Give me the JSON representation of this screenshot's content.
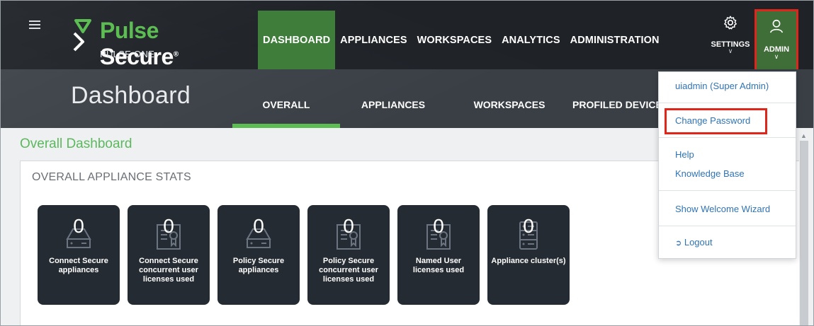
{
  "app": {
    "brand_pulse": "Pulse",
    "brand_secure": "Secure",
    "brand_reg": "®",
    "product": "PULSE ONE"
  },
  "nav": {
    "items": [
      {
        "label": "DASHBOARD",
        "active": true
      },
      {
        "label": "APPLIANCES",
        "active": false
      },
      {
        "label": "WORKSPACES",
        "active": false
      },
      {
        "label": "ANALYTICS",
        "active": false
      },
      {
        "label": "ADMINISTRATION",
        "active": false
      }
    ],
    "settings_label": "SETTINGS",
    "admin_label": "ADMIN"
  },
  "subbar": {
    "title": "Dashboard",
    "tabs": [
      {
        "label": "OVERALL",
        "active": true
      },
      {
        "label": "APPLIANCES",
        "active": false
      },
      {
        "label": "WORKSPACES",
        "active": false
      },
      {
        "label": "PROFILED DEVICES",
        "active": false
      }
    ]
  },
  "content": {
    "section_title": "Overall Dashboard",
    "panel_title": "OVERALL APPLIANCE STATS",
    "cards": [
      {
        "value": "0",
        "label": "Connect Secure appliances",
        "icon": "appliance-icon"
      },
      {
        "value": "0",
        "label": "Connect Secure concurrent user licenses used",
        "icon": "license-certificate-icon"
      },
      {
        "value": "0",
        "label": "Policy Secure appliances",
        "icon": "appliance-icon"
      },
      {
        "value": "0",
        "label": "Policy Secure concurrent user licenses used",
        "icon": "license-certificate-icon"
      },
      {
        "value": "0",
        "label": "Named User licenses used",
        "icon": "license-certificate-icon"
      },
      {
        "value": "0",
        "label": "Appliance cluster(s)",
        "icon": "cluster-icon"
      }
    ]
  },
  "admin_menu": {
    "user": "uiadmin (Super Admin)",
    "change_password": "Change Password",
    "help": "Help",
    "knowledge_base": "Knowledge Base",
    "welcome_wizard": "Show Welcome Wizard",
    "logout": "Logout"
  },
  "colors": {
    "accent_green": "#5cbd53",
    "active_nav": "#3f7d3a",
    "highlight_red": "#e0261a",
    "link_blue": "#2f74b5"
  }
}
